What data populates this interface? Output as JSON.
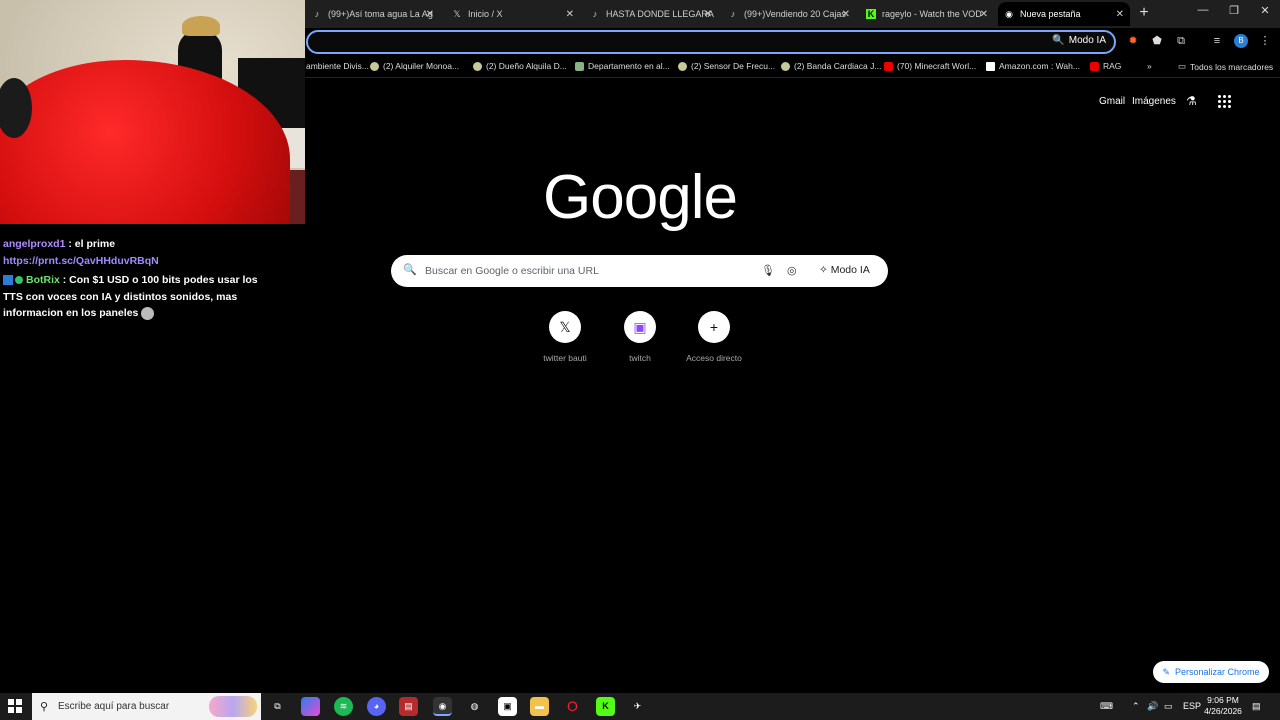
{
  "tabs": [
    {
      "title": "(99+)Así toma agua La Ag",
      "icon": "tiktok-icon",
      "active": false
    },
    {
      "title": "Inicio / X",
      "icon": "x-icon",
      "active": false
    },
    {
      "title": "HASTA DONDE LLEGARA",
      "icon": "tiktok-icon",
      "active": false
    },
    {
      "title": "(99+)Vendiendo 20 Cajas",
      "icon": "tiktok-icon",
      "active": false
    },
    {
      "title": "rageylo - Watch the VOD",
      "icon": "kick-icon",
      "active": false
    },
    {
      "title": "Nueva pestaña",
      "icon": "chrome-icon",
      "active": true
    }
  ],
  "toolbar": {
    "modo_ia": "Modo IA",
    "profile_initial": "B"
  },
  "bookmarks": [
    {
      "label": "ambiente Divis...",
      "icon": "bookmark-icon"
    },
    {
      "label": "(2) Alquiler Monoa...",
      "icon": "marketplace-icon"
    },
    {
      "label": "(2) Dueño Alquila D...",
      "icon": "marketplace-icon"
    },
    {
      "label": "Departamento en al...",
      "icon": "image-icon"
    },
    {
      "label": "(2) Sensor De Frecu...",
      "icon": "marketplace-icon"
    },
    {
      "label": "(2) Banda Cardiaca J...",
      "icon": "marketplace-icon"
    },
    {
      "label": "(70) Minecraft Worl...",
      "icon": "youtube-icon"
    },
    {
      "label": "Amazon.com : Wah...",
      "icon": "amazon-icon"
    },
    {
      "label": "RAG",
      "icon": "youtube-icon"
    }
  ],
  "bookmarks_more": "»",
  "bookmarks_all": "Todos los marcadores",
  "chat": {
    "msg1_user": "angelproxd1",
    "msg1_text": " : el prime",
    "msg1_link": "https://prnt.sc/QavHHduvRBqN",
    "msg2_user": "BotRix",
    "msg2_text": " : Con $1 USD o 100 bits podes usar los TTS con voces con IA y distintos sonidos, mas informacion en los paneles"
  },
  "google": {
    "gmail": "Gmail",
    "images": "Imágenes",
    "logo": "Google",
    "search_placeholder": "Buscar en Google o escribir una URL",
    "ai_mode": "Modo IA",
    "shortcuts": [
      {
        "label": "twitter bauti",
        "icon": "x-icon"
      },
      {
        "label": "twitch",
        "icon": "twitch-icon"
      },
      {
        "label": "Acceso directo",
        "icon": "plus-icon"
      }
    ],
    "customize": "Personalizar Chrome"
  },
  "taskbar": {
    "search_placeholder": "Escribe aquí para buscar",
    "lang": "ESP",
    "time": "9:06 PM",
    "date": "4/26/2026"
  },
  "colors": {
    "accent": "#7aa7ff",
    "chat_bot": "#6ee06e",
    "chat_user": "#b18cff",
    "link": "#9f8cff"
  }
}
